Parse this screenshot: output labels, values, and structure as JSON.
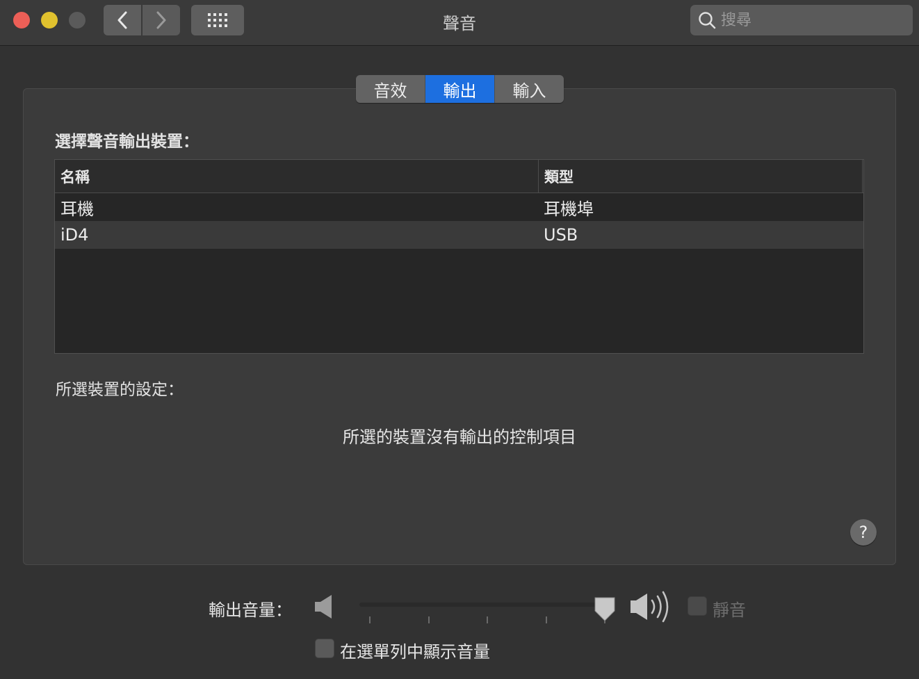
{
  "window": {
    "title": "聲音"
  },
  "toolbar": {
    "search_placeholder": "搜尋",
    "back_icon": "chevron-left-icon",
    "forward_icon": "chevron-right-icon",
    "show_all_icon": "grid-icon"
  },
  "tabs": [
    {
      "label": "音效",
      "active": false
    },
    {
      "label": "輸出",
      "active": true
    },
    {
      "label": "輸入",
      "active": false
    }
  ],
  "output": {
    "section_label": "選擇聲音輸出裝置：",
    "columns": [
      "名稱",
      "類型"
    ],
    "rows": [
      {
        "name": "耳機",
        "type": "耳機埠",
        "selected": false
      },
      {
        "name": "iD4",
        "type": "USB",
        "selected": true
      }
    ],
    "settings_label": "所選裝置的設定：",
    "no_controls_message": "所選的裝置沒有輸出的控制項目",
    "help_label": "?"
  },
  "volume": {
    "label": "輸出音量：",
    "level": 1.0,
    "mute_label": "靜音",
    "mute_checked": false,
    "mute_enabled": false,
    "show_in_menubar_label": "在選單列中顯示音量",
    "show_in_menubar_checked": false
  },
  "colors": {
    "accent": "#1d6fe0",
    "close": "#ec5f57",
    "minimize": "#e0c12e"
  }
}
